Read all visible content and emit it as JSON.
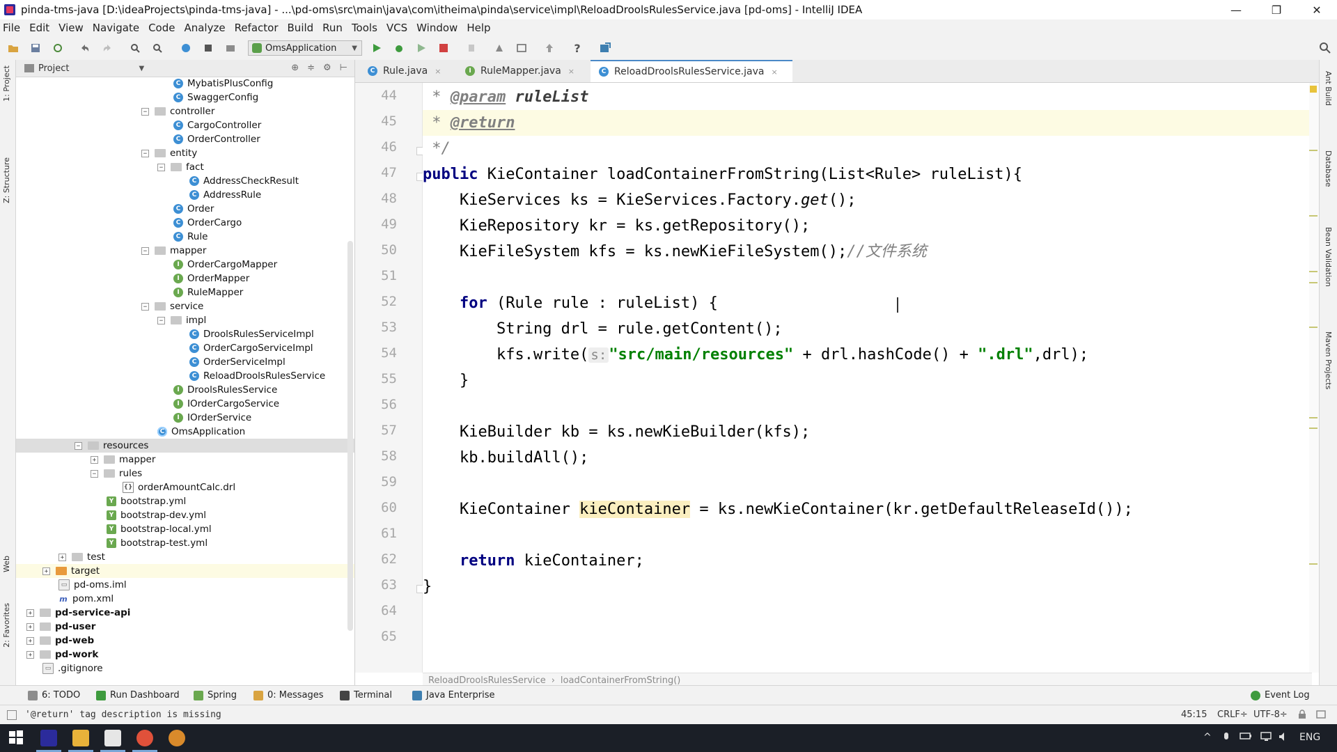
{
  "window": {
    "title": "pinda-tms-java [D:\\ideaProjects\\pinda-tms-java] - ...\\pd-oms\\src\\main\\java\\com\\itheima\\pinda\\service\\impl\\ReloadDroolsRulesService.java [pd-oms] - IntelliJ IDEA",
    "minimize": "—",
    "restore": "❐",
    "close": "✕"
  },
  "menu": [
    "File",
    "Edit",
    "View",
    "Navigate",
    "Code",
    "Analyze",
    "Refactor",
    "Build",
    "Run",
    "Tools",
    "VCS",
    "Window",
    "Help"
  ],
  "toolbar": {
    "run_config": "OmsApplication",
    "run_config_arrow": "▼"
  },
  "left_strip": {
    "project": "1: Project",
    "structure": "Z: Structure",
    "web": "Web",
    "favorites": "2: Favorites"
  },
  "project": {
    "header": "Project",
    "header_arrow": "▼",
    "tools": [
      "⊕",
      "≑",
      "⚙",
      "⊢"
    ],
    "tree": [
      {
        "label": "MybatisPlusConfig",
        "icon": "C"
      },
      {
        "label": "SwaggerConfig",
        "icon": "C"
      },
      {
        "label": "controller",
        "expander": "−"
      },
      {
        "label": "CargoController",
        "icon": "C"
      },
      {
        "label": "OrderController",
        "icon": "C"
      },
      {
        "label": "entity",
        "expander": "−"
      },
      {
        "label": "fact",
        "expander": "−"
      },
      {
        "label": "AddressCheckResult",
        "icon": "C"
      },
      {
        "label": "AddressRule",
        "icon": "C"
      },
      {
        "label": "Order",
        "icon": "C"
      },
      {
        "label": "OrderCargo",
        "icon": "C"
      },
      {
        "label": "Rule",
        "icon": "C"
      },
      {
        "label": "mapper",
        "expander": "−"
      },
      {
        "label": "OrderCargoMapper",
        "icon": "I"
      },
      {
        "label": "OrderMapper",
        "icon": "I"
      },
      {
        "label": "RuleMapper",
        "icon": "I"
      },
      {
        "label": "service",
        "expander": "−"
      },
      {
        "label": "impl",
        "expander": "−"
      },
      {
        "label": "DroolsRulesServiceImpl",
        "icon": "C"
      },
      {
        "label": "OrderCargoServiceImpl",
        "icon": "C"
      },
      {
        "label": "OrderServiceImpl",
        "icon": "C"
      },
      {
        "label": "ReloadDroolsRulesService",
        "icon": "C"
      },
      {
        "label": "DroolsRulesService",
        "icon": "I"
      },
      {
        "label": "IOrderCargoService",
        "icon": "I"
      },
      {
        "label": "IOrderService",
        "icon": "I"
      },
      {
        "label": "OmsApplication",
        "icon": "C"
      },
      {
        "label": "resources",
        "expander": "−"
      },
      {
        "label": "mapper",
        "expander": "+"
      },
      {
        "label": "rules",
        "expander": "−"
      },
      {
        "label": "orderAmountCalc.drl",
        "icon": "{}"
      },
      {
        "label": "bootstrap.yml",
        "icon": "Y"
      },
      {
        "label": "bootstrap-dev.yml",
        "icon": "Y"
      },
      {
        "label": "bootstrap-local.yml",
        "icon": "Y"
      },
      {
        "label": "bootstrap-test.yml",
        "icon": "Y"
      },
      {
        "label": "test",
        "expander": "+"
      },
      {
        "label": "target",
        "expander": "+"
      },
      {
        "label": "pd-oms.iml",
        "icon": "▭"
      },
      {
        "label": "pom.xml",
        "icon": "m"
      },
      {
        "label": "pd-service-api",
        "expander": "+"
      },
      {
        "label": "pd-user",
        "expander": "+"
      },
      {
        "label": "pd-web",
        "expander": "+"
      },
      {
        "label": "pd-work",
        "expander": "+"
      },
      {
        "label": ".gitignore",
        "icon": "▭"
      }
    ]
  },
  "tabs": [
    {
      "label": "Rule.java",
      "icon": "C",
      "close": "×"
    },
    {
      "label": "RuleMapper.java",
      "icon": "I",
      "close": "×"
    },
    {
      "label": "ReloadDroolsRulesService.java",
      "icon": "C",
      "close": "×"
    }
  ],
  "editor": {
    "line_numbers": [
      "44",
      "45",
      "46",
      "47",
      "48",
      "49",
      "50",
      "51",
      "52",
      "53",
      "54",
      "55",
      "56",
      "57",
      "58",
      "59",
      "60",
      "61",
      "62",
      "63",
      "64",
      "65"
    ],
    "code": {
      "l44_star": " * ",
      "l44_tag": "@param",
      "l44_rest": " ruleList",
      "l45_star": " * ",
      "l45_tag": "@return",
      "l46": " */",
      "l47_kw": "public",
      "l47_rest": " KieContainer loadContainerFromString(List<Rule> ruleList){",
      "l48_a": "    KieServices ks = KieServices.Factory.",
      "l48_get": "get",
      "l48_b": "();",
      "l49": "    KieRepository kr = ks.getRepository();",
      "l50_a": "    KieFileSystem kfs = ks.newKieFileSystem();",
      "l50_cm": "//文件系统",
      "l52_kw": "for",
      "l52_rest": " (Rule rule : ruleList) {",
      "l53": "        String drl = rule.getContent();",
      "l54_a": "        kfs.write(",
      "l54_hint": "s:",
      "l54_str": "\"src/main/resources\"",
      "l54_b": " + drl.hashCode() + ",
      "l54_str2": "\".drl\"",
      "l54_c": ",drl);",
      "l55": "    }",
      "l57": "    KieBuilder kb = ks.newKieBuilder(kfs);",
      "l58": "    kb.buildAll();",
      "l60_a": "    KieContainer ",
      "l60_mark": "kieContainer",
      "l60_b": " = ks.newKieContainer(kr.getDefaultReleaseId());",
      "l62_kw": "return",
      "l62_rest": " kieContainer;",
      "l63": "}",
      "l64": "}"
    },
    "breadcrumb": [
      "ReloadDroolsRulesService",
      "loadContainerFromString()"
    ],
    "breadcrumb_sep": "›"
  },
  "right_strip": {
    "ant": "Ant Build",
    "database": "Database",
    "bean": "Bean Validation",
    "maven": "Maven Projects"
  },
  "tool_windows": [
    "6: TODO",
    "Run Dashboard",
    "Spring",
    "0: Messages",
    "Terminal",
    "Java Enterprise",
    "Event Log"
  ],
  "status": {
    "message": "'@return' tag description is missing",
    "position": "45:15",
    "line_sep": "CRLF÷",
    "encoding": "UTF-8÷"
  },
  "taskbar": {
    "lang": "ENG",
    "chevron": "^"
  },
  "colors": {
    "keyword": "#000080",
    "string": "#008000",
    "comment": "#808080",
    "accent": "#4a88c7",
    "taskbar": "#1b1f27"
  }
}
